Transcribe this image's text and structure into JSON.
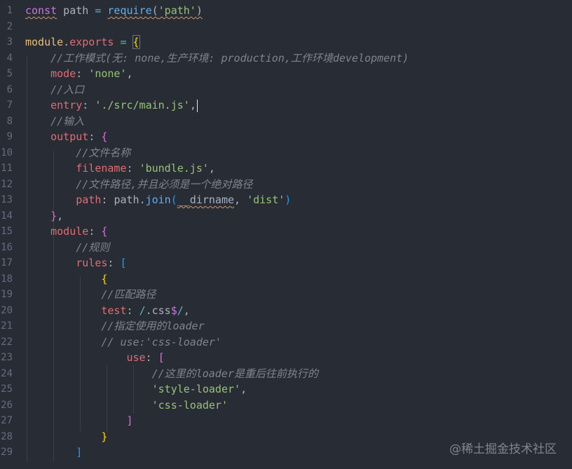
{
  "lines": [
    {
      "n": "1",
      "tokens": [
        {
          "t": "const",
          "c": "kw squig"
        },
        {
          "t": " path ",
          "c": "plain"
        },
        {
          "t": "=",
          "c": "op"
        },
        {
          "t": " ",
          "c": "plain"
        },
        {
          "t": "require",
          "c": "fn squig"
        },
        {
          "t": "(",
          "c": "plain squig"
        },
        {
          "t": "'path'",
          "c": "str squig"
        },
        {
          "t": ")",
          "c": "plain squig"
        }
      ]
    },
    {
      "n": "2",
      "tokens": []
    },
    {
      "n": "3",
      "tokens": [
        {
          "t": "module",
          "c": "obj"
        },
        {
          "t": ".",
          "c": "plain"
        },
        {
          "t": "exports",
          "c": "prop"
        },
        {
          "t": " ",
          "c": "plain"
        },
        {
          "t": "=",
          "c": "op"
        },
        {
          "t": " ",
          "c": "plain"
        },
        {
          "t": "{",
          "c": "b1 bmatch"
        }
      ]
    },
    {
      "n": "4",
      "tokens": [
        {
          "t": "    ",
          "c": "plain"
        },
        {
          "t": "//工作模式(无: none,生产环境: production,工作环境development)",
          "c": "cm"
        }
      ]
    },
    {
      "n": "5",
      "tokens": [
        {
          "t": "    ",
          "c": "plain"
        },
        {
          "t": "mode",
          "c": "prop"
        },
        {
          "t": ": ",
          "c": "plain"
        },
        {
          "t": "'none'",
          "c": "str"
        },
        {
          "t": ",",
          "c": "plain"
        }
      ]
    },
    {
      "n": "6",
      "tokens": [
        {
          "t": "    ",
          "c": "plain"
        },
        {
          "t": "//入口",
          "c": "cm"
        }
      ]
    },
    {
      "n": "7",
      "tokens": [
        {
          "t": "    ",
          "c": "plain"
        },
        {
          "t": "entry",
          "c": "prop"
        },
        {
          "t": ": ",
          "c": "plain"
        },
        {
          "t": "'./src/main.js'",
          "c": "str"
        },
        {
          "t": ",",
          "c": "plain"
        },
        {
          "t": "",
          "c": "cursor"
        }
      ]
    },
    {
      "n": "8",
      "tokens": [
        {
          "t": "    ",
          "c": "plain"
        },
        {
          "t": "//输入",
          "c": "cm"
        }
      ]
    },
    {
      "n": "9",
      "tokens": [
        {
          "t": "    ",
          "c": "plain"
        },
        {
          "t": "output",
          "c": "prop"
        },
        {
          "t": ": ",
          "c": "plain"
        },
        {
          "t": "{",
          "c": "b2"
        }
      ]
    },
    {
      "n": "10",
      "tokens": [
        {
          "t": "        ",
          "c": "plain"
        },
        {
          "t": "//文件名称",
          "c": "cm"
        }
      ]
    },
    {
      "n": "11",
      "tokens": [
        {
          "t": "        ",
          "c": "plain"
        },
        {
          "t": "filename",
          "c": "prop"
        },
        {
          "t": ": ",
          "c": "plain"
        },
        {
          "t": "'bundle.js'",
          "c": "str"
        },
        {
          "t": ",",
          "c": "plain"
        }
      ]
    },
    {
      "n": "12",
      "tokens": [
        {
          "t": "        ",
          "c": "plain"
        },
        {
          "t": "//文件路径,并且必须是一个绝对路径",
          "c": "cm"
        }
      ]
    },
    {
      "n": "13",
      "tokens": [
        {
          "t": "        ",
          "c": "plain"
        },
        {
          "t": "path",
          "c": "prop"
        },
        {
          "t": ": ",
          "c": "plain"
        },
        {
          "t": "path",
          "c": "plain"
        },
        {
          "t": ".",
          "c": "plain"
        },
        {
          "t": "join",
          "c": "fn"
        },
        {
          "t": "(",
          "c": "b3"
        },
        {
          "t": "__dirname",
          "c": "plain squig"
        },
        {
          "t": ", ",
          "c": "plain"
        },
        {
          "t": "'dist'",
          "c": "str"
        },
        {
          "t": ")",
          "c": "b3"
        }
      ]
    },
    {
      "n": "14",
      "tokens": [
        {
          "t": "    ",
          "c": "plain"
        },
        {
          "t": "}",
          "c": "b2"
        },
        {
          "t": ",",
          "c": "plain"
        }
      ]
    },
    {
      "n": "15",
      "tokens": [
        {
          "t": "    ",
          "c": "plain"
        },
        {
          "t": "module",
          "c": "prop"
        },
        {
          "t": ": ",
          "c": "plain"
        },
        {
          "t": "{",
          "c": "b2"
        }
      ]
    },
    {
      "n": "16",
      "tokens": [
        {
          "t": "        ",
          "c": "plain"
        },
        {
          "t": "//规则",
          "c": "cm"
        }
      ]
    },
    {
      "n": "17",
      "tokens": [
        {
          "t": "        ",
          "c": "plain"
        },
        {
          "t": "rules",
          "c": "prop"
        },
        {
          "t": ": ",
          "c": "plain"
        },
        {
          "t": "[",
          "c": "b3"
        }
      ]
    },
    {
      "n": "18",
      "tokens": [
        {
          "t": "            ",
          "c": "plain"
        },
        {
          "t": "{",
          "c": "b1"
        }
      ]
    },
    {
      "n": "19",
      "tokens": [
        {
          "t": "            ",
          "c": "plain"
        },
        {
          "t": "//匹配路径",
          "c": "cm"
        }
      ]
    },
    {
      "n": "20",
      "tokens": [
        {
          "t": "            ",
          "c": "plain"
        },
        {
          "t": "test",
          "c": "prop"
        },
        {
          "t": ": ",
          "c": "plain"
        },
        {
          "t": "/",
          "c": "op"
        },
        {
          "t": ".css",
          "c": "plain"
        },
        {
          "t": "$",
          "c": "kw"
        },
        {
          "t": "/",
          "c": "op"
        },
        {
          "t": ",",
          "c": "plain"
        }
      ]
    },
    {
      "n": "21",
      "tokens": [
        {
          "t": "            ",
          "c": "plain"
        },
        {
          "t": "//指定使用的loader",
          "c": "cm"
        }
      ]
    },
    {
      "n": "22",
      "tokens": [
        {
          "t": "            ",
          "c": "plain"
        },
        {
          "t": "// use:'css-loader'",
          "c": "cm"
        }
      ]
    },
    {
      "n": "23",
      "tokens": [
        {
          "t": "                ",
          "c": "plain"
        },
        {
          "t": "use",
          "c": "prop"
        },
        {
          "t": ": ",
          "c": "plain"
        },
        {
          "t": "[",
          "c": "b2"
        }
      ]
    },
    {
      "n": "24",
      "tokens": [
        {
          "t": "                    ",
          "c": "plain"
        },
        {
          "t": "//这里的loader是重后往前执行的",
          "c": "cm"
        }
      ]
    },
    {
      "n": "25",
      "tokens": [
        {
          "t": "                    ",
          "c": "plain"
        },
        {
          "t": "'style-loader'",
          "c": "str"
        },
        {
          "t": ",",
          "c": "plain"
        }
      ]
    },
    {
      "n": "26",
      "tokens": [
        {
          "t": "                    ",
          "c": "plain"
        },
        {
          "t": "'css-loader'",
          "c": "str"
        }
      ]
    },
    {
      "n": "27",
      "tokens": [
        {
          "t": "                ",
          "c": "plain"
        },
        {
          "t": "]",
          "c": "b2"
        }
      ]
    },
    {
      "n": "28",
      "tokens": [
        {
          "t": "        ",
          "c": "plain"
        },
        {
          "t": "    ",
          "c": "plain"
        },
        {
          "t": "}",
          "c": "b1"
        }
      ]
    },
    {
      "n": "29",
      "tokens": [
        {
          "t": "        ",
          "c": "plain"
        },
        {
          "t": "]",
          "c": "b3"
        }
      ]
    }
  ],
  "watermark": "@稀土掘金技术社区"
}
